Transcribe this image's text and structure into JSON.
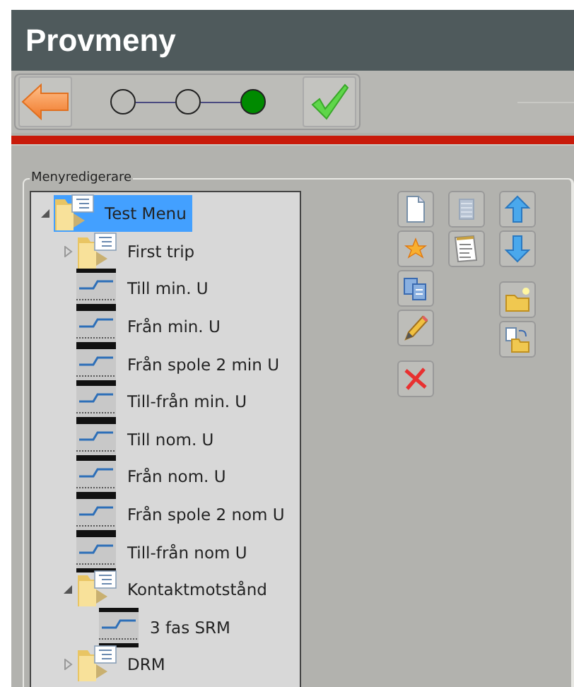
{
  "window": {
    "title": "Provmeny"
  },
  "steps": [
    {
      "selected": false
    },
    {
      "selected": false
    },
    {
      "selected": true
    }
  ],
  "editor": {
    "label": "Menyredigerare",
    "tree": [
      {
        "kind": "folder",
        "label": "Test Menu",
        "selected": true,
        "expanded": true,
        "children": [
          {
            "kind": "folder",
            "label": "First trip",
            "selected": false,
            "expanded": false
          },
          {
            "kind": "test",
            "label": "Till min. U",
            "selected": false
          },
          {
            "kind": "test",
            "label": "Från min. U",
            "selected": false
          },
          {
            "kind": "test",
            "label": "Från spole 2 min U",
            "selected": false
          },
          {
            "kind": "test",
            "label": "Till-från min. U",
            "selected": false
          },
          {
            "kind": "test",
            "label": "Till nom. U",
            "selected": false
          },
          {
            "kind": "test",
            "label": "Från nom. U",
            "selected": false
          },
          {
            "kind": "test",
            "label": "Från spole 2 nom U",
            "selected": false
          },
          {
            "kind": "test",
            "label": "Till-från nom U",
            "selected": false
          },
          {
            "kind": "folder",
            "label": "Kontaktmotstånd",
            "selected": false,
            "expanded": true,
            "children": [
              {
                "kind": "test",
                "label": "3 fas SRM",
                "selected": false
              }
            ]
          },
          {
            "kind": "folder",
            "label": "DRM",
            "selected": false,
            "expanded": false
          }
        ]
      }
    ]
  }
}
